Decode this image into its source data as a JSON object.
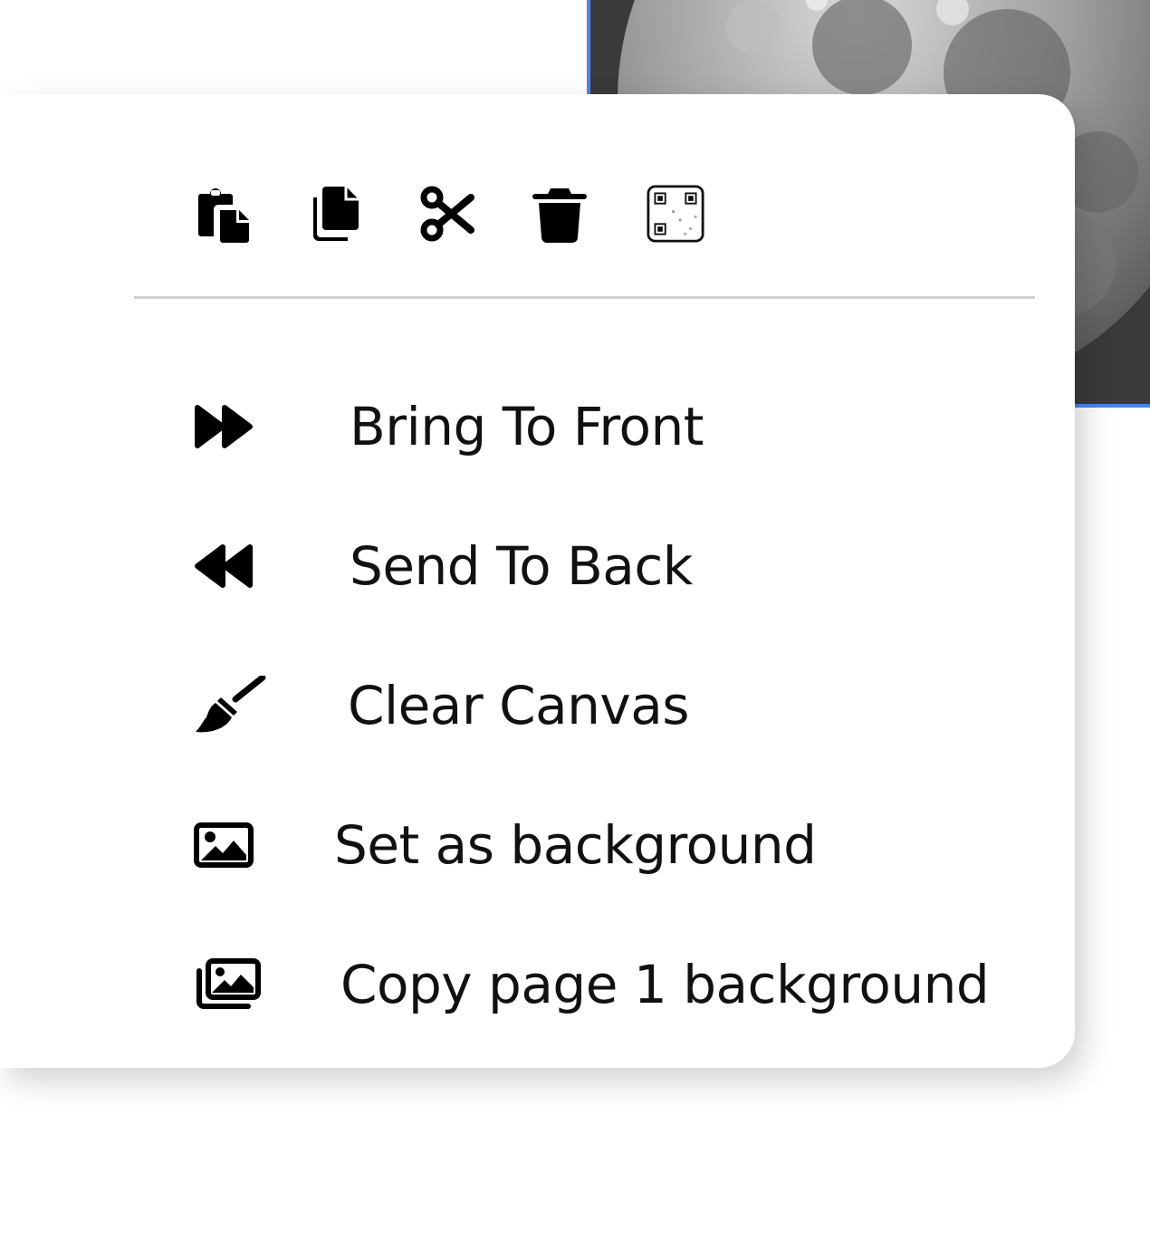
{
  "quick_actions": [
    {
      "name": "paste",
      "icon": "paste-icon"
    },
    {
      "name": "copy",
      "icon": "copy-icon"
    },
    {
      "name": "cut",
      "icon": "scissors-icon"
    },
    {
      "name": "delete",
      "icon": "trash-icon"
    },
    {
      "name": "qr-code",
      "icon": "qr-code-icon"
    }
  ],
  "menu": {
    "items": [
      {
        "label": "Bring To Front",
        "icon": "forward-icon"
      },
      {
        "label": "Send To Back",
        "icon": "backward-icon"
      },
      {
        "label": "Clear Canvas",
        "icon": "broom-icon"
      },
      {
        "label": "Set as background",
        "icon": "image-icon"
      },
      {
        "label": "Copy page 1 background",
        "icon": "images-icon"
      }
    ]
  },
  "colors": {
    "selection_border": "#4a86e8",
    "divider": "#cfcfcf",
    "text": "#111111",
    "icon": "#000000"
  }
}
